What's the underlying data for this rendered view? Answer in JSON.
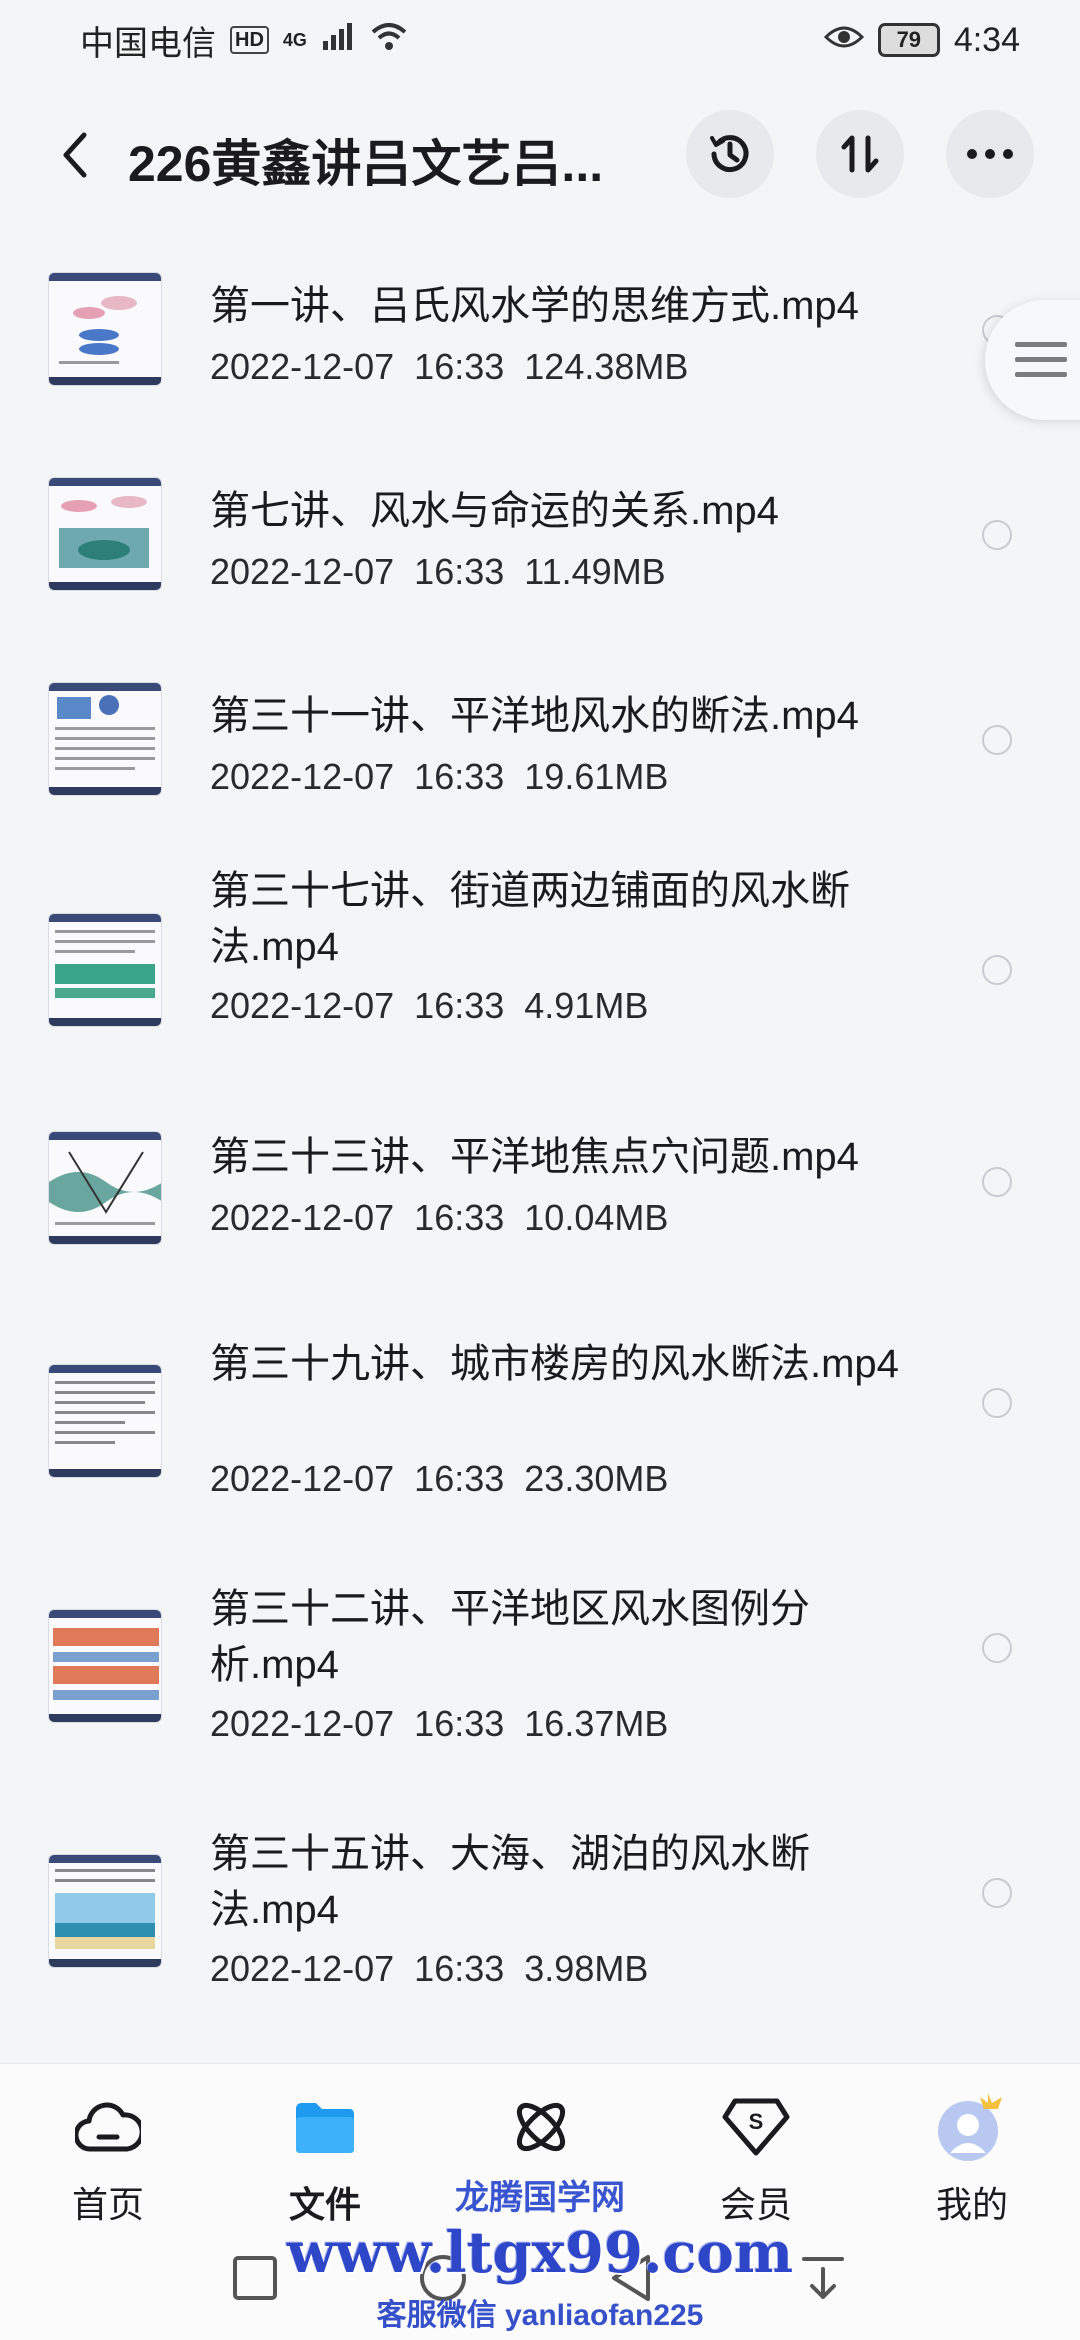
{
  "status_bar": {
    "carrier": "中国电信",
    "hd": "HD",
    "network": "4G",
    "battery": "79",
    "time": "4:34"
  },
  "header": {
    "title": "226黄鑫讲吕文艺吕...",
    "back_icon": "back-arrow-icon",
    "history_icon": "history-icon",
    "sort_icon": "sort-icon",
    "more_icon": "more-icon"
  },
  "files": [
    {
      "name": "第一讲、吕氏风水学的思维方式.mp4",
      "date": "2022-12-07",
      "time": "16:33",
      "size": "124.38MB"
    },
    {
      "name": "第七讲、风水与命运的关系.mp4",
      "date": "2022-12-07",
      "time": "16:33",
      "size": "11.49MB"
    },
    {
      "name": "第三十一讲、平洋地风水的断法.mp4",
      "date": "2022-12-07",
      "time": "16:33",
      "size": "19.61MB"
    },
    {
      "name": "第三十七讲、街道两边铺面的风水断法.mp4",
      "date": "2022-12-07",
      "time": "16:33",
      "size": "4.91MB"
    },
    {
      "name": "第三十三讲、平洋地焦点穴问题.mp4",
      "date": "2022-12-07",
      "time": "16:33",
      "size": "10.04MB"
    },
    {
      "name": "第三十九讲、城市楼房的风水断法.mp4",
      "date": "2022-12-07",
      "time": "16:33",
      "size": "23.30MB"
    },
    {
      "name": "第三十二讲、平洋地区风水图例分析.mp4",
      "date": "2022-12-07",
      "time": "16:33",
      "size": "16.37MB"
    },
    {
      "name": "第三十五讲、大海、湖泊的风水断法.mp4",
      "date": "2022-12-07",
      "time": "16:33",
      "size": "3.98MB"
    }
  ],
  "bottom_nav": {
    "items": [
      {
        "label": "首页",
        "icon": "cloud-home-icon"
      },
      {
        "label": "文件",
        "icon": "folder-icon",
        "active": true
      },
      {
        "label": "",
        "icon": "atom-icon"
      },
      {
        "label": "会员",
        "icon": "vip-diamond-icon"
      },
      {
        "label": "我的",
        "icon": "avatar-icon"
      }
    ]
  },
  "watermark": {
    "line1": "龙腾国学网",
    "line2": "www.ltgx99.com",
    "line3": "客服微信 yanliaofan225"
  },
  "colors": {
    "accent": "#1e9bf0",
    "background": "#f4f5f7",
    "watermark": "#3550c9"
  }
}
